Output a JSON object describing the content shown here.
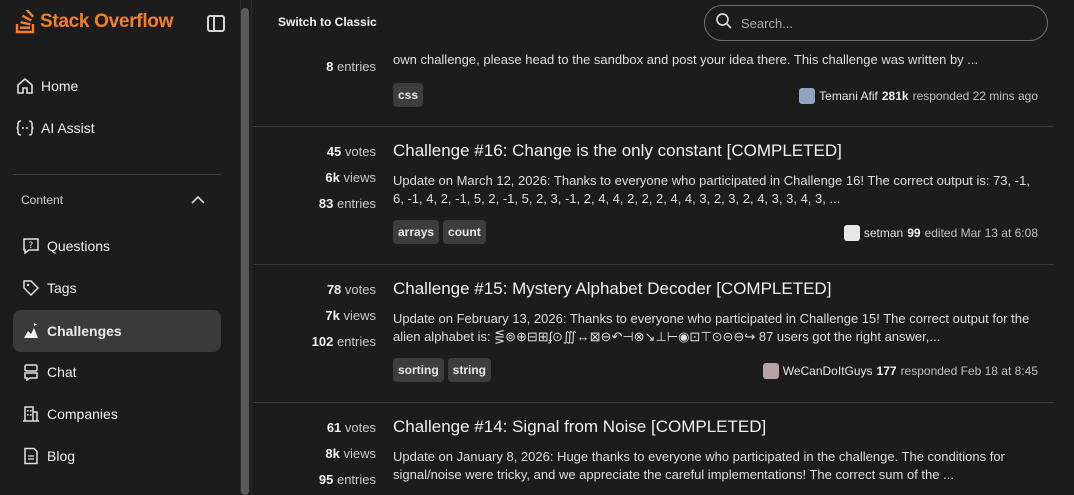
{
  "app": {
    "logo_text": "Stack Overflow",
    "accent": "#f48024"
  },
  "topbar": {
    "switch_label": "Switch to Classic",
    "search_placeholder": "Search..."
  },
  "sidebar": {
    "primary": [
      {
        "label": "Home",
        "icon": "home-icon"
      },
      {
        "label": "AI Assist",
        "icon": "ai-assist-icon"
      }
    ],
    "section_title": "Content",
    "items": [
      {
        "label": "Questions",
        "icon": "questions-icon"
      },
      {
        "label": "Tags",
        "icon": "tag-icon"
      },
      {
        "label": "Challenges",
        "icon": "challenges-icon",
        "active": true
      },
      {
        "label": "Chat",
        "icon": "chat-icon"
      },
      {
        "label": "Companies",
        "icon": "companies-icon"
      },
      {
        "label": "Blog",
        "icon": "blog-icon"
      }
    ]
  },
  "questions": [
    {
      "entries": "8",
      "entries_label": "entries",
      "excerpt": "own challenge, please head to the sandbox and post your idea there. This challenge was written by ...",
      "tags": [
        "css"
      ],
      "user": "Temani Afif",
      "rep": "281k",
      "action": "responded 22 mins ago"
    },
    {
      "votes": "45",
      "votes_label": "votes",
      "views": "6k",
      "views_label": "views",
      "entries": "83",
      "entries_label": "entries",
      "title": "Challenge #16: Change is the only constant [COMPLETED]",
      "excerpt": "Update on March 12, 2026: Thanks to everyone who participated in Challenge 16! The correct output is: 73, -1, 6, -1, 4, 2, -1, 5, 2, -1, 5, 2, 3, -1, 2, 4, 4, 2, 2, 2, 4, 4, 3, 2, 3, 2, 4, 3, 3, 4, 3, ...",
      "tags": [
        "arrays",
        "count"
      ],
      "user": "setman",
      "rep": "99",
      "action": "edited Mar 13 at 6:08"
    },
    {
      "votes": "78",
      "votes_label": "votes",
      "views": "7k",
      "views_label": "views",
      "entries": "102",
      "entries_label": "entries",
      "title": "Challenge #15: Mystery Alphabet Decoder [COMPLETED]",
      "excerpt": "Update on February 13, 2026: Thanks to everyone who participated in Challenge 15! The correct output for the alien alphabet is: ⋚⊚⊕⊟⊞ʄ⊙∭↔⊠⊖↶⊣⊗↘⊥⊢◉⊡⊤⊙⊝⊖↪ 87 users got the right answer,...",
      "tags": [
        "sorting",
        "string"
      ],
      "user": "WeCanDoItGuys",
      "rep": "177",
      "action": "responded Feb 18 at 8:45"
    },
    {
      "votes": "61",
      "votes_label": "votes",
      "views": "8k",
      "views_label": "views",
      "entries": "95",
      "entries_label": "entries",
      "title": "Challenge #14: Signal from Noise [COMPLETED]",
      "excerpt": "Update on January 8, 2026: Huge thanks to everyone who participated in the challenge. The conditions for signal/noise were tricky, and we appreciate the careful implementations! The correct sum of the ..."
    }
  ]
}
